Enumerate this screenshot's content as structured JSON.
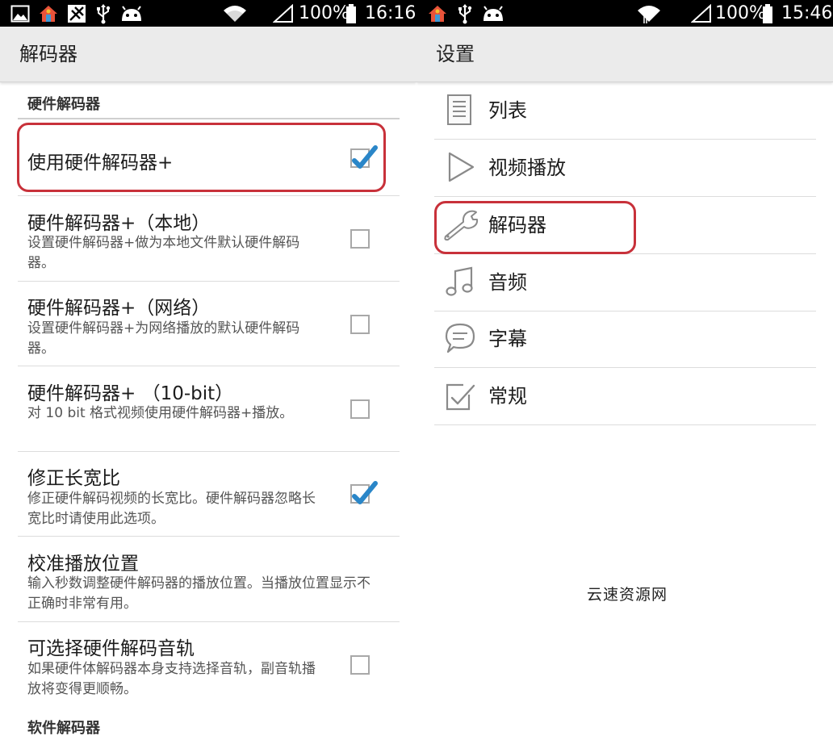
{
  "left": {
    "status": {
      "battery": "100%",
      "time": "16:16"
    },
    "title": "解码器",
    "section_hardware": "硬件解码器",
    "section_software": "软件解码器",
    "prefs": [
      {
        "title": "使用硬件解码器+",
        "summary": "",
        "checked": true
      },
      {
        "title": "硬件解码器+（本地）",
        "summary": "设置硬件解码器+做为本地文件默认硬件解码器。",
        "checked": false
      },
      {
        "title": "硬件解码器+（网络）",
        "summary": "设置硬件解码器+为网络播放的默认硬件解码器。",
        "checked": false
      },
      {
        "title": "硬件解码器+ （10-bit）",
        "summary": "对 10 bit 格式视频使用硬件解码器+播放。",
        "checked": false
      },
      {
        "title": "修正长宽比",
        "summary": "修正硬件解码视频的长宽比。硬件解码器忽略长宽比时请使用此选项。",
        "checked": true
      },
      {
        "title": "校准播放位置",
        "summary": "输入秒数调整硬件解码器的播放位置。当播放位置显示不正确时非常有用。"
      },
      {
        "title": "可选择硬件解码音轨",
        "summary": "如果硬件体解码器本身支持选择音轨，副音轨播放将变得更顺畅。",
        "checked": false
      }
    ]
  },
  "right": {
    "status": {
      "battery": "100%",
      "time": "15:46"
    },
    "title": "设置",
    "items": [
      {
        "label": "列表",
        "icon": "list-icon"
      },
      {
        "label": "视频播放",
        "icon": "play-icon"
      },
      {
        "label": "解码器",
        "icon": "wrench-icon"
      },
      {
        "label": "音频",
        "icon": "music-note-icon"
      },
      {
        "label": "字幕",
        "icon": "speech-bubble-icon"
      },
      {
        "label": "常规",
        "icon": "checkbox-icon"
      }
    ],
    "watermark": "云速资源网"
  },
  "colors": {
    "highlight": "#c8313a",
    "check": "#2a86c8",
    "actionbar": "#ebebeb",
    "statusbar": "#000000"
  }
}
